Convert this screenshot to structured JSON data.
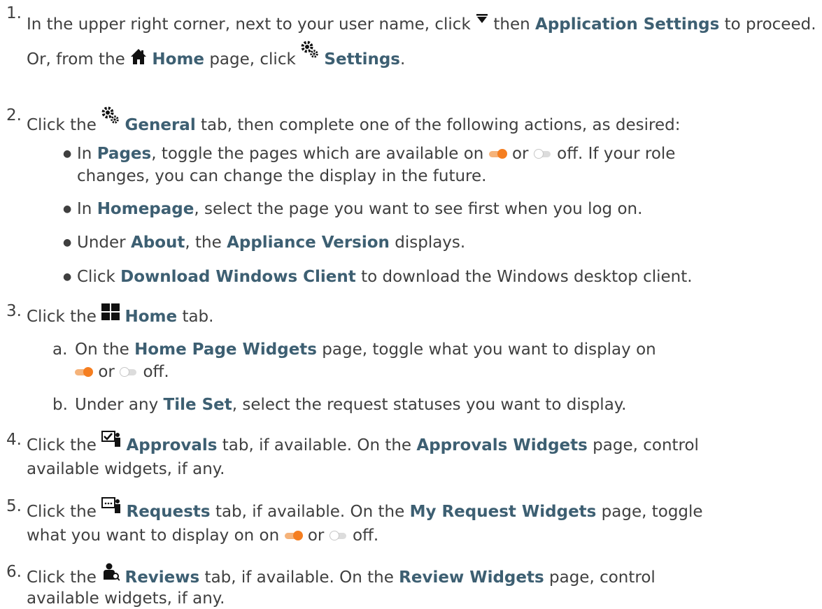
{
  "step1": {
    "num": "1.",
    "t1": "In the upper right corner, next to your user name, click",
    "t2": "then",
    "b1": "Application Settings",
    "t3": "to proceed. Or, from the",
    "b2": "Home",
    "t4": "page, click",
    "b3": "Settings",
    "t5": "."
  },
  "step2": {
    "num": "2.",
    "t1": "Click the",
    "b1": "General",
    "t2": "tab, then complete one of the following actions, as desired:",
    "bullets": {
      "a": {
        "t1": "In",
        "b1": "Pages",
        "t2": ", toggle the pages which are available on",
        "t3": "or",
        "t4": "off. If your role",
        "t5": "changes, you can change the display in the future."
      },
      "b": {
        "t1": "In",
        "b1": "Homepage",
        "t2": ", select the page you want to see first when you log on."
      },
      "c": {
        "t1": "Under",
        "b1": "About",
        "t2": ", the",
        "b2": "Appliance Version",
        "t3": "displays."
      },
      "d": {
        "t1": "Click",
        "b1": "Download Windows Client",
        "t2": "to download the Windows desktop client."
      }
    }
  },
  "step3": {
    "num": "3.",
    "t1": "Click the",
    "b1": "Home",
    "t2": "tab.",
    "a": {
      "lbl": "a.",
      "t1": "On the",
      "b1": "Home Page Widgets",
      "t2": "page, toggle what you want to display on",
      "t3": "or",
      "t4": "off."
    },
    "b": {
      "lbl": "b.",
      "t1": "Under any",
      "b1": "Tile Set",
      "t2": ", select the request statuses you want to display."
    }
  },
  "step4": {
    "num": "4.",
    "t1": "Click the",
    "b1": "Approvals",
    "t2": "tab, if available. On the",
    "b2": "Approvals Widgets",
    "t3": "page, control",
    "t4": "available widgets, if any."
  },
  "step5": {
    "num": "5.",
    "t1": "Click the",
    "b1": "Requests",
    "t2": "tab, if available. On the",
    "b2": "My Request Widgets",
    "t3": "page, toggle",
    "t4": "what you want to display on on",
    "t5": "or",
    "t6": "off."
  },
  "step6": {
    "num": "6.",
    "t1": "Click the",
    "b1": "Reviews",
    "t2": "tab, if available. On the",
    "b2": "Review Widgets",
    "t3": "page, control",
    "t4": "available widgets, if any."
  },
  "colors": {
    "text": "#3f3f3f",
    "highlight": "#3d5f72",
    "toggle_on": "#f57e20",
    "toggle_off": "#dcdcdc"
  },
  "icons": [
    "dropdown-arrow-icon",
    "home-icon",
    "settings-gears-icon",
    "home-tiles-icon",
    "approvals-icon",
    "requests-icon",
    "reviews-icon",
    "toggle-on-icon",
    "toggle-off-icon"
  ]
}
